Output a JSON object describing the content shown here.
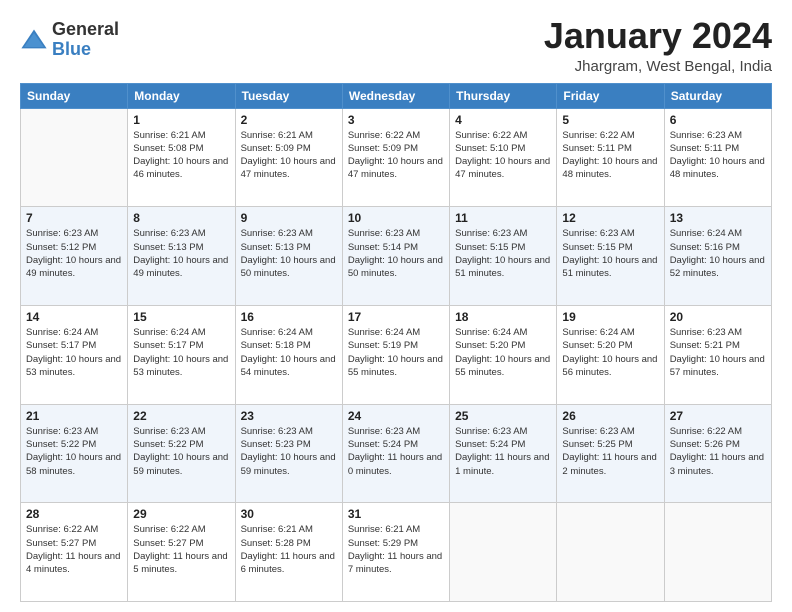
{
  "logo": {
    "general": "General",
    "blue": "Blue"
  },
  "header": {
    "month_year": "January 2024",
    "location": "Jhargram, West Bengal, India"
  },
  "columns": [
    "Sunday",
    "Monday",
    "Tuesday",
    "Wednesday",
    "Thursday",
    "Friday",
    "Saturday"
  ],
  "weeks": [
    [
      {
        "day": "",
        "sunrise": "",
        "sunset": "",
        "daylight": ""
      },
      {
        "day": "1",
        "sunrise": "Sunrise: 6:21 AM",
        "sunset": "Sunset: 5:08 PM",
        "daylight": "Daylight: 10 hours and 46 minutes."
      },
      {
        "day": "2",
        "sunrise": "Sunrise: 6:21 AM",
        "sunset": "Sunset: 5:09 PM",
        "daylight": "Daylight: 10 hours and 47 minutes."
      },
      {
        "day": "3",
        "sunrise": "Sunrise: 6:22 AM",
        "sunset": "Sunset: 5:09 PM",
        "daylight": "Daylight: 10 hours and 47 minutes."
      },
      {
        "day": "4",
        "sunrise": "Sunrise: 6:22 AM",
        "sunset": "Sunset: 5:10 PM",
        "daylight": "Daylight: 10 hours and 47 minutes."
      },
      {
        "day": "5",
        "sunrise": "Sunrise: 6:22 AM",
        "sunset": "Sunset: 5:11 PM",
        "daylight": "Daylight: 10 hours and 48 minutes."
      },
      {
        "day": "6",
        "sunrise": "Sunrise: 6:23 AM",
        "sunset": "Sunset: 5:11 PM",
        "daylight": "Daylight: 10 hours and 48 minutes."
      }
    ],
    [
      {
        "day": "7",
        "sunrise": "Sunrise: 6:23 AM",
        "sunset": "Sunset: 5:12 PM",
        "daylight": "Daylight: 10 hours and 49 minutes."
      },
      {
        "day": "8",
        "sunrise": "Sunrise: 6:23 AM",
        "sunset": "Sunset: 5:13 PM",
        "daylight": "Daylight: 10 hours and 49 minutes."
      },
      {
        "day": "9",
        "sunrise": "Sunrise: 6:23 AM",
        "sunset": "Sunset: 5:13 PM",
        "daylight": "Daylight: 10 hours and 50 minutes."
      },
      {
        "day": "10",
        "sunrise": "Sunrise: 6:23 AM",
        "sunset": "Sunset: 5:14 PM",
        "daylight": "Daylight: 10 hours and 50 minutes."
      },
      {
        "day": "11",
        "sunrise": "Sunrise: 6:23 AM",
        "sunset": "Sunset: 5:15 PM",
        "daylight": "Daylight: 10 hours and 51 minutes."
      },
      {
        "day": "12",
        "sunrise": "Sunrise: 6:23 AM",
        "sunset": "Sunset: 5:15 PM",
        "daylight": "Daylight: 10 hours and 51 minutes."
      },
      {
        "day": "13",
        "sunrise": "Sunrise: 6:24 AM",
        "sunset": "Sunset: 5:16 PM",
        "daylight": "Daylight: 10 hours and 52 minutes."
      }
    ],
    [
      {
        "day": "14",
        "sunrise": "Sunrise: 6:24 AM",
        "sunset": "Sunset: 5:17 PM",
        "daylight": "Daylight: 10 hours and 53 minutes."
      },
      {
        "day": "15",
        "sunrise": "Sunrise: 6:24 AM",
        "sunset": "Sunset: 5:17 PM",
        "daylight": "Daylight: 10 hours and 53 minutes."
      },
      {
        "day": "16",
        "sunrise": "Sunrise: 6:24 AM",
        "sunset": "Sunset: 5:18 PM",
        "daylight": "Daylight: 10 hours and 54 minutes."
      },
      {
        "day": "17",
        "sunrise": "Sunrise: 6:24 AM",
        "sunset": "Sunset: 5:19 PM",
        "daylight": "Daylight: 10 hours and 55 minutes."
      },
      {
        "day": "18",
        "sunrise": "Sunrise: 6:24 AM",
        "sunset": "Sunset: 5:20 PM",
        "daylight": "Daylight: 10 hours and 55 minutes."
      },
      {
        "day": "19",
        "sunrise": "Sunrise: 6:24 AM",
        "sunset": "Sunset: 5:20 PM",
        "daylight": "Daylight: 10 hours and 56 minutes."
      },
      {
        "day": "20",
        "sunrise": "Sunrise: 6:23 AM",
        "sunset": "Sunset: 5:21 PM",
        "daylight": "Daylight: 10 hours and 57 minutes."
      }
    ],
    [
      {
        "day": "21",
        "sunrise": "Sunrise: 6:23 AM",
        "sunset": "Sunset: 5:22 PM",
        "daylight": "Daylight: 10 hours and 58 minutes."
      },
      {
        "day": "22",
        "sunrise": "Sunrise: 6:23 AM",
        "sunset": "Sunset: 5:22 PM",
        "daylight": "Daylight: 10 hours and 59 minutes."
      },
      {
        "day": "23",
        "sunrise": "Sunrise: 6:23 AM",
        "sunset": "Sunset: 5:23 PM",
        "daylight": "Daylight: 10 hours and 59 minutes."
      },
      {
        "day": "24",
        "sunrise": "Sunrise: 6:23 AM",
        "sunset": "Sunset: 5:24 PM",
        "daylight": "Daylight: 11 hours and 0 minutes."
      },
      {
        "day": "25",
        "sunrise": "Sunrise: 6:23 AM",
        "sunset": "Sunset: 5:24 PM",
        "daylight": "Daylight: 11 hours and 1 minute."
      },
      {
        "day": "26",
        "sunrise": "Sunrise: 6:23 AM",
        "sunset": "Sunset: 5:25 PM",
        "daylight": "Daylight: 11 hours and 2 minutes."
      },
      {
        "day": "27",
        "sunrise": "Sunrise: 6:22 AM",
        "sunset": "Sunset: 5:26 PM",
        "daylight": "Daylight: 11 hours and 3 minutes."
      }
    ],
    [
      {
        "day": "28",
        "sunrise": "Sunrise: 6:22 AM",
        "sunset": "Sunset: 5:27 PM",
        "daylight": "Daylight: 11 hours and 4 minutes."
      },
      {
        "day": "29",
        "sunrise": "Sunrise: 6:22 AM",
        "sunset": "Sunset: 5:27 PM",
        "daylight": "Daylight: 11 hours and 5 minutes."
      },
      {
        "day": "30",
        "sunrise": "Sunrise: 6:21 AM",
        "sunset": "Sunset: 5:28 PM",
        "daylight": "Daylight: 11 hours and 6 minutes."
      },
      {
        "day": "31",
        "sunrise": "Sunrise: 6:21 AM",
        "sunset": "Sunset: 5:29 PM",
        "daylight": "Daylight: 11 hours and 7 minutes."
      },
      {
        "day": "",
        "sunrise": "",
        "sunset": "",
        "daylight": ""
      },
      {
        "day": "",
        "sunrise": "",
        "sunset": "",
        "daylight": ""
      },
      {
        "day": "",
        "sunrise": "",
        "sunset": "",
        "daylight": ""
      }
    ]
  ]
}
